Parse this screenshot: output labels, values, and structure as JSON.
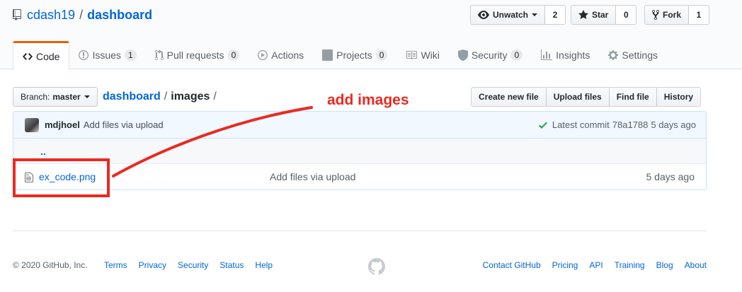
{
  "repo": {
    "owner": "cdash19",
    "separator": "/",
    "name": "dashboard"
  },
  "actions": {
    "watch": {
      "label": "Unwatch",
      "count": "2"
    },
    "star": {
      "label": "Star",
      "count": "0"
    },
    "fork": {
      "label": "Fork",
      "count": "1"
    }
  },
  "tabs": [
    {
      "label": "Code",
      "counter": "",
      "icon": "code-icon",
      "selected": true
    },
    {
      "label": "Issues",
      "counter": "1",
      "icon": "issue-icon"
    },
    {
      "label": "Pull requests",
      "counter": "0",
      "icon": "pull-request-icon"
    },
    {
      "label": "Actions",
      "counter": "",
      "icon": "play-icon"
    },
    {
      "label": "Projects",
      "counter": "0",
      "icon": "project-icon"
    },
    {
      "label": "Wiki",
      "counter": "",
      "icon": "book-icon"
    },
    {
      "label": "Security",
      "counter": "0",
      "icon": "shield-icon"
    },
    {
      "label": "Insights",
      "counter": "",
      "icon": "graph-icon"
    },
    {
      "label": "Settings",
      "counter": "",
      "icon": "gear-icon"
    }
  ],
  "branch": {
    "prefix": "Branch:",
    "name": "master"
  },
  "breadcrumb": {
    "root": "dashboard",
    "separator": "/",
    "folder": "images",
    "trailing": "/"
  },
  "file_actions": {
    "create": "Create new file",
    "upload": "Upload files",
    "find": "Find file",
    "history": "History"
  },
  "commit": {
    "author": "mdjhoel",
    "message": "Add files via upload",
    "latest_label": "Latest commit",
    "sha": "78a1788",
    "age": "5 days ago"
  },
  "files": {
    "up": "..",
    "rows": [
      {
        "name": "ex_code.png",
        "message": "Add files via upload",
        "age": "5 days ago",
        "icon": "file-icon"
      }
    ]
  },
  "annotation": {
    "label": "add images",
    "color": "#ea2a22"
  },
  "footer": {
    "copyright": "© 2020 GitHub, Inc.",
    "left_links": [
      "Terms",
      "Privacy",
      "Security",
      "Status",
      "Help"
    ],
    "right_links": [
      "Contact GitHub",
      "Pricing",
      "API",
      "Training",
      "Blog",
      "About"
    ]
  },
  "colors": {
    "link": "#0366d6",
    "selected_tab_accent": "#e36209",
    "commit_bg": "#f1f8ff",
    "success": "#28a745"
  }
}
